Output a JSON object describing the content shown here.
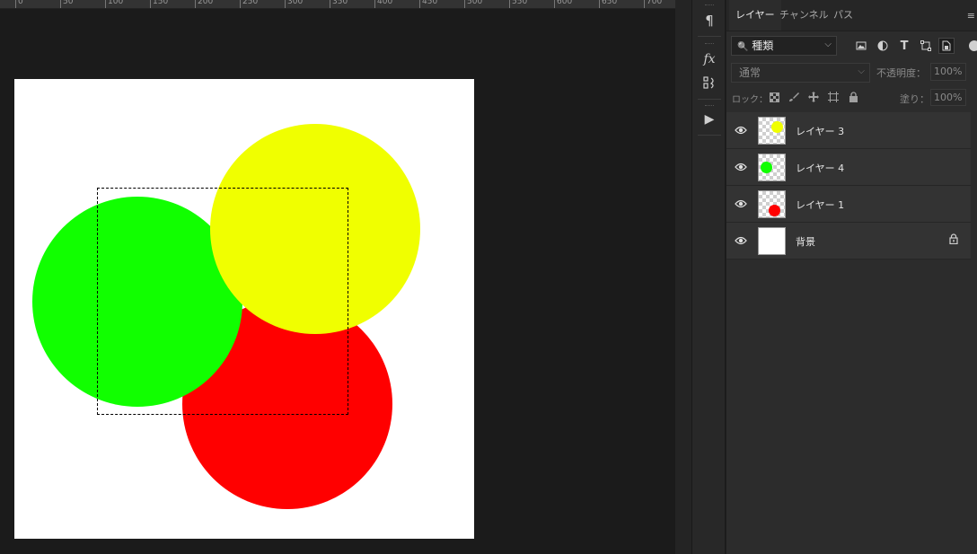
{
  "ruler": {
    "labels": [
      "0",
      "50",
      "100",
      "150",
      "200",
      "250",
      "300",
      "350",
      "400",
      "450",
      "500",
      "550",
      "600",
      "650",
      "700"
    ]
  },
  "canvas": {
    "background_color": "#ffffff",
    "circles": [
      {
        "name": "red-circle",
        "color": "#ff0000"
      },
      {
        "name": "green-circle",
        "color": "#11ff00"
      },
      {
        "name": "yellow-circle",
        "color": "#f0ff00"
      }
    ]
  },
  "mini_toolbar": {
    "icons": [
      "paragraph-icon",
      "fx-icon",
      "adjust-icon",
      "play-icon"
    ],
    "paragraph": "¶",
    "fx": "fx",
    "play": "▶"
  },
  "panel": {
    "tabs": [
      {
        "label": "レイヤー",
        "active": true
      },
      {
        "label": "チャンネル",
        "active": false
      },
      {
        "label": "パス",
        "active": false
      }
    ],
    "menu_icon": "≡",
    "filter": {
      "kind_label": "種類",
      "search_icon": "🔍"
    },
    "blend": {
      "mode": "通常",
      "opacity_label": "不透明度：",
      "opacity_value": "100%"
    },
    "lock": {
      "label": "ロック：",
      "fill_label": "塗り：",
      "fill_value": "100%"
    },
    "layers": [
      {
        "name": "レイヤー 3",
        "visible": true,
        "thumb_dot_color": "#f0ff00",
        "locked": false
      },
      {
        "name": "レイヤー 4",
        "visible": true,
        "thumb_dot_color": "#11ff00",
        "locked": false
      },
      {
        "name": "レイヤー 1",
        "visible": true,
        "thumb_dot_color": "#ff0000",
        "locked": false
      },
      {
        "name": "背景",
        "visible": true,
        "thumb_dot_color": "",
        "locked": true
      }
    ]
  }
}
